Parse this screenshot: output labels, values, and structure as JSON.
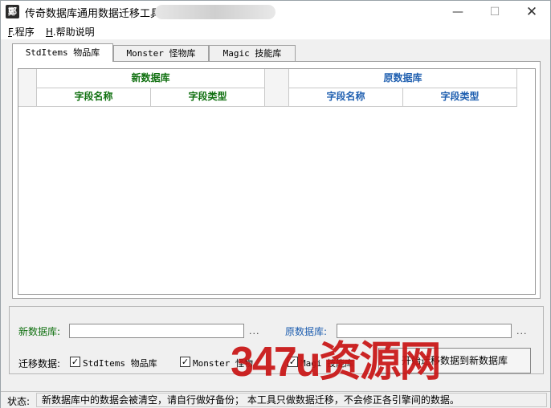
{
  "window": {
    "title": "传奇数据库通用数据迁移工具",
    "icon_glyph": "鄭",
    "controls": {
      "minimize": "—",
      "maximize": "☐",
      "close": "✕"
    }
  },
  "menu": {
    "items": [
      {
        "hotkey": "F",
        "label": ".程序"
      },
      {
        "hotkey": "H",
        "label": ".帮助说明"
      }
    ]
  },
  "tabs": [
    {
      "label": "StdItems 物品库",
      "active": true
    },
    {
      "label": "Monster 怪物库",
      "active": false
    },
    {
      "label": "Magic 技能库",
      "active": false
    }
  ],
  "grid": {
    "new_db_header": "新数据库",
    "orig_db_header": "原数据库",
    "columns": {
      "field_name": "字段名称",
      "field_type": "字段类型"
    }
  },
  "form": {
    "new_db_label": "新数据库:",
    "new_db_value": "",
    "orig_db_label": "原数据库:",
    "orig_db_value": "",
    "browse_dots": "...",
    "migrate_label": "迁移数据:",
    "checkboxes": [
      {
        "label": "StdItems 物品库",
        "checked": true
      },
      {
        "label": "Monster 怪物",
        "checked": true
      },
      {
        "label": "Magi 技能库",
        "checked": true
      }
    ],
    "start_button": "开始迁移数据到新数据库"
  },
  "watermark": "347u资源网",
  "status": {
    "label": "状态:",
    "text": "新数据库中的数据会被清空，请自行做好备份；   本工具只做数据迁移，不会修正各引擎间的数据。"
  },
  "colors": {
    "new_db_green": "#107010",
    "orig_db_blue": "#1f5fb0",
    "watermark_red": "#c81414"
  }
}
